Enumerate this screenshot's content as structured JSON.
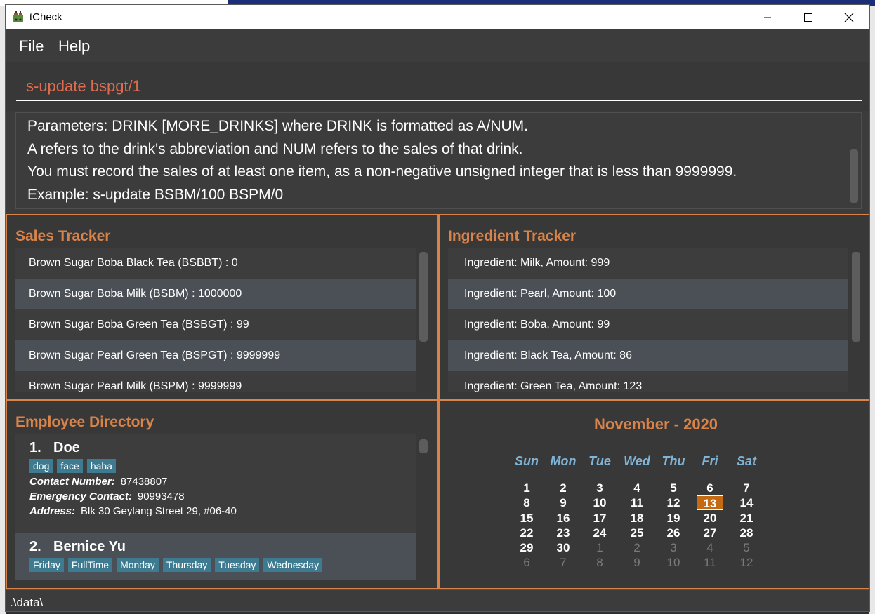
{
  "window": {
    "title": "tCheck"
  },
  "menu": {
    "file": "File",
    "help": "Help"
  },
  "command": {
    "value": "s-update bspgt/1"
  },
  "result": {
    "lines": [
      "Parameters: DRINK [MORE_DRINKS] where DRINK is formatted as A/NUM.",
      "A refers to the drink's abbreviation and NUM refers to the sales of that drink.",
      "You must record the sales of at least one item, as a non-negative unsigned integer that is less than 9999999.",
      "Example: s-update BSBM/100 BSPM/0"
    ]
  },
  "sales": {
    "title": "Sales Tracker",
    "items": [
      "Brown Sugar Boba Black Tea (BSBBT) : 0",
      "Brown Sugar Boba Milk (BSBM) : 1000000",
      "Brown Sugar Boba Green Tea (BSBGT) : 99",
      "Brown Sugar Pearl Green Tea (BSPGT) : 9999999",
      "Brown Sugar Pearl Milk (BSPM) : 9999999"
    ]
  },
  "ingredients": {
    "title": "Ingredient Tracker",
    "items": [
      "Ingredient: Milk,  Amount: 999",
      "Ingredient: Pearl,  Amount: 100",
      "Ingredient: Boba,  Amount: 99",
      "Ingredient: Black Tea,  Amount: 86",
      "Ingredient: Green Tea,  Amount: 123"
    ]
  },
  "employees": {
    "title": "Employee Directory",
    "labels": {
      "contact": "Contact Number:",
      "emergency": "Emergency Contact:",
      "address": "Address:"
    },
    "items": [
      {
        "index": "1.",
        "name": "Doe",
        "tags": [
          "dog",
          "face",
          "haha"
        ],
        "contact": "87438807",
        "emergency": "90993478",
        "address": "Blk 30 Geylang Street 29, #06-40"
      },
      {
        "index": "2.",
        "name": "Bernice Yu",
        "tags": [
          "Friday",
          "FullTime",
          "Monday",
          "Thursday",
          "Tuesday",
          "Wednesday"
        ]
      }
    ]
  },
  "calendar": {
    "title": "November - 2020",
    "weekdays": [
      "Sun",
      "Mon",
      "Tue",
      "Wed",
      "Thu",
      "Fri",
      "Sat"
    ],
    "today": "13",
    "weeks": [
      [
        [
          "1",
          1
        ],
        [
          "2",
          1
        ],
        [
          "3",
          1
        ],
        [
          "4",
          1
        ],
        [
          "5",
          1
        ],
        [
          "6",
          1
        ],
        [
          "7",
          1
        ]
      ],
      [
        [
          "8",
          1
        ],
        [
          "9",
          1
        ],
        [
          "10",
          1
        ],
        [
          "11",
          1
        ],
        [
          "12",
          1
        ],
        [
          "13",
          1
        ],
        [
          "14",
          1
        ]
      ],
      [
        [
          "15",
          1
        ],
        [
          "16",
          1
        ],
        [
          "17",
          1
        ],
        [
          "18",
          1
        ],
        [
          "19",
          1
        ],
        [
          "20",
          1
        ],
        [
          "21",
          1
        ]
      ],
      [
        [
          "22",
          1
        ],
        [
          "23",
          1
        ],
        [
          "24",
          1
        ],
        [
          "25",
          1
        ],
        [
          "26",
          1
        ],
        [
          "27",
          1
        ],
        [
          "28",
          1
        ]
      ],
      [
        [
          "29",
          1
        ],
        [
          "30",
          1
        ],
        [
          "1",
          0
        ],
        [
          "2",
          0
        ],
        [
          "3",
          0
        ],
        [
          "4",
          0
        ],
        [
          "5",
          0
        ]
      ],
      [
        [
          "6",
          0
        ],
        [
          "7",
          0
        ],
        [
          "8",
          0
        ],
        [
          "9",
          0
        ],
        [
          "10",
          0
        ],
        [
          "11",
          0
        ],
        [
          "12",
          0
        ]
      ]
    ]
  },
  "status": {
    "path": ".\\data\\"
  },
  "colors": {
    "accent": "#d8834a",
    "tag": "#3e7b91",
    "command_text": "#e06c4f",
    "weekday": "#7fb4d6",
    "today": "#c46a12"
  }
}
